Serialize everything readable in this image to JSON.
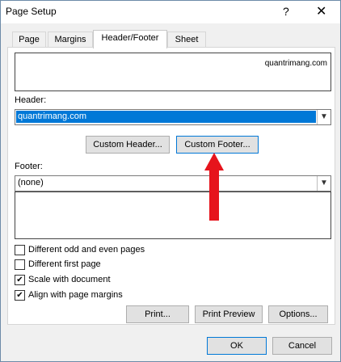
{
  "window": {
    "title": "Page Setup",
    "help_glyph": "?",
    "close_glyph": "✕"
  },
  "tabs": [
    "Page",
    "Margins",
    "Header/Footer",
    "Sheet"
  ],
  "preview": {
    "header_text": "quantrimang.com"
  },
  "header": {
    "label": "Header:",
    "value": "quantrimang.com"
  },
  "buttons": {
    "custom_header": "Custom Header...",
    "custom_footer": "Custom Footer...",
    "print": "Print...",
    "print_preview": "Print Preview",
    "options": "Options...",
    "ok": "OK",
    "cancel": "Cancel"
  },
  "footer": {
    "label": "Footer:",
    "value": "(none)"
  },
  "checkboxes": [
    {
      "label": "Different odd and even pages",
      "checked": false
    },
    {
      "label": "Different first page",
      "checked": false
    },
    {
      "label": "Scale with document",
      "checked": true
    },
    {
      "label": "Align with page margins",
      "checked": true
    }
  ],
  "colors": {
    "selection": "#0078d7",
    "arrow": "#e6141c"
  }
}
